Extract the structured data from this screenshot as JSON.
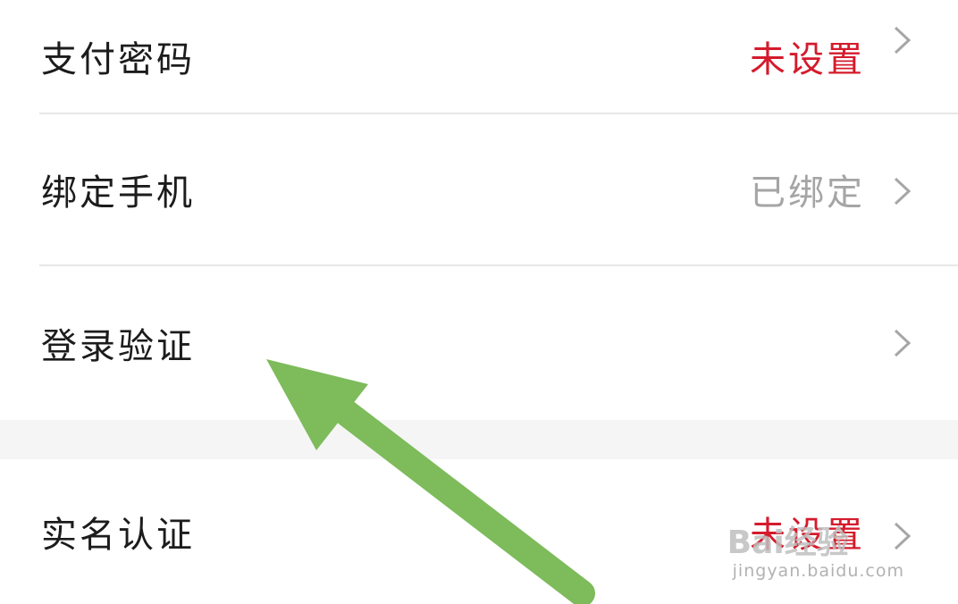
{
  "settings": {
    "rows": [
      {
        "label": "支付密码",
        "value": "未设置",
        "value_color": "#d41b2c"
      },
      {
        "label": "绑定手机",
        "value": "已绑定",
        "value_color": "#a5a5a5"
      },
      {
        "label": "登录验证",
        "value": ""
      },
      {
        "label": "实名认证",
        "value": "未设置",
        "value_color": "#d41b2c"
      }
    ]
  },
  "annotation": {
    "type": "arrow",
    "color": "#7dbb5b",
    "target": "登录验证"
  },
  "watermark": {
    "brand": "Bai经验",
    "url": "jingyan.baidu.com"
  }
}
